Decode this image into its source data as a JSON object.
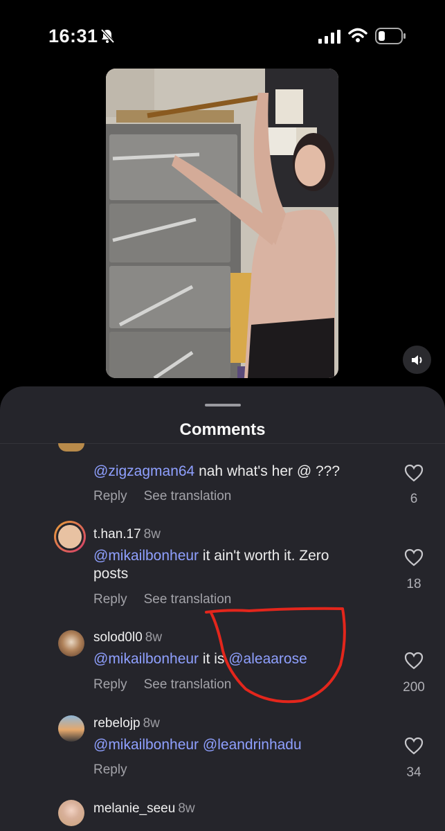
{
  "status": {
    "time": "16:31"
  },
  "sheet": {
    "title": "Comments"
  },
  "comments": [
    {
      "user": "",
      "time": "",
      "mentions": [
        "@zigzagman64"
      ],
      "text": " nah what's her @ ???",
      "reply": "Reply",
      "translate": "See translation",
      "likes": "6"
    },
    {
      "user": "t.han.17",
      "time": "8w",
      "mentions": [
        "@mikailbonheur"
      ],
      "text": " it ain't worth it. Zero posts",
      "reply": "Reply",
      "translate": "See translation",
      "likes": "18"
    },
    {
      "user": "solod0l0",
      "time": "8w",
      "mentions": [
        "@mikailbonheur",
        "@aleaarose"
      ],
      "text": " it is ",
      "reply": "Reply",
      "translate": "See translation",
      "likes": "200"
    },
    {
      "user": "rebelojp",
      "time": "8w",
      "mentions": [
        "@mikailbonheur",
        "@leandrinhadu"
      ],
      "text": " ",
      "reply": "Reply",
      "likes": "34"
    },
    {
      "user": "melanie_seeu",
      "time": "8w"
    }
  ],
  "colors": {
    "sheet": "#25252b",
    "mention": "#8fa0ff",
    "annotation": "#e3261c"
  }
}
